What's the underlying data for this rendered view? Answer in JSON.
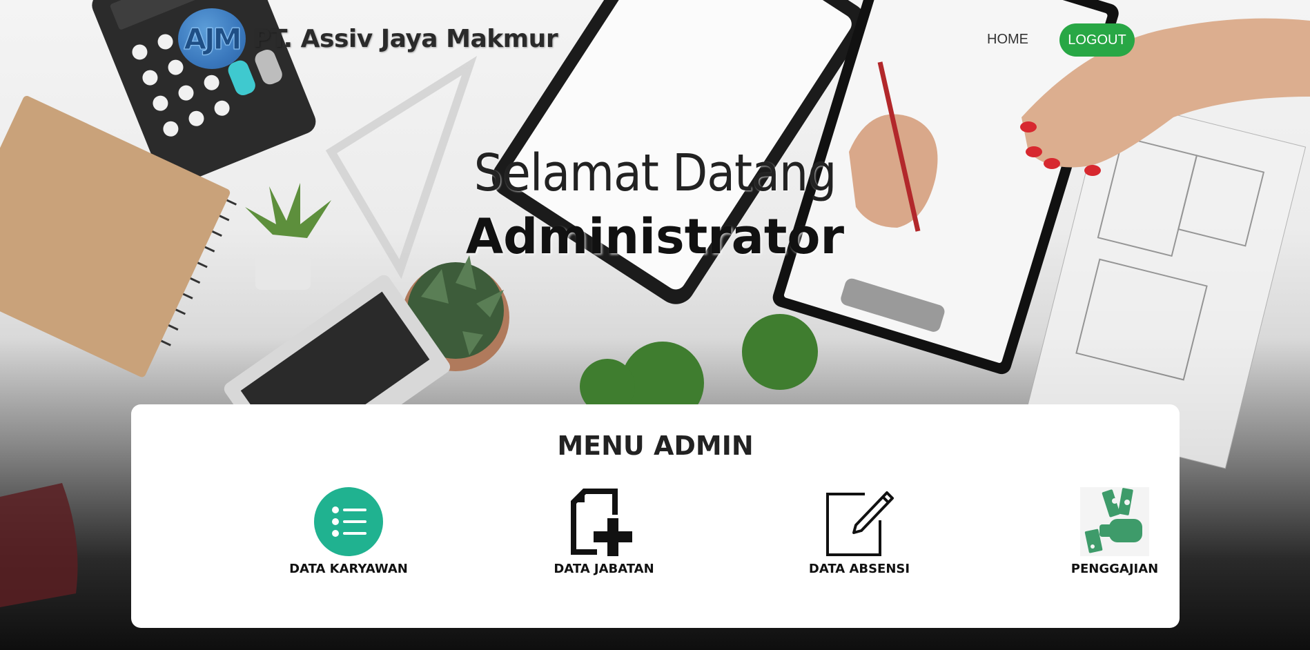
{
  "brand": {
    "logo_text": "AJM",
    "name": "PT. Assiv Jaya Makmur"
  },
  "nav": {
    "home_label": "HOME",
    "logout_label": "LOGOUT"
  },
  "welcome": {
    "line1": "Selamat Datang",
    "line2": "Administrator"
  },
  "menu": {
    "title": "MENU ADMIN",
    "items": [
      {
        "label": "DATA KARYAWAN",
        "icon": "list-icon"
      },
      {
        "label": "DATA JABATAN",
        "icon": "add-document-icon"
      },
      {
        "label": "DATA ABSENSI",
        "icon": "edit-icon"
      },
      {
        "label": "PENGGAJIAN",
        "icon": "money-hand-icon"
      }
    ]
  },
  "colors": {
    "logout_bg": "#28a745",
    "list_icon_bg": "#20b290",
    "money_icon": "#3e9b6a"
  }
}
